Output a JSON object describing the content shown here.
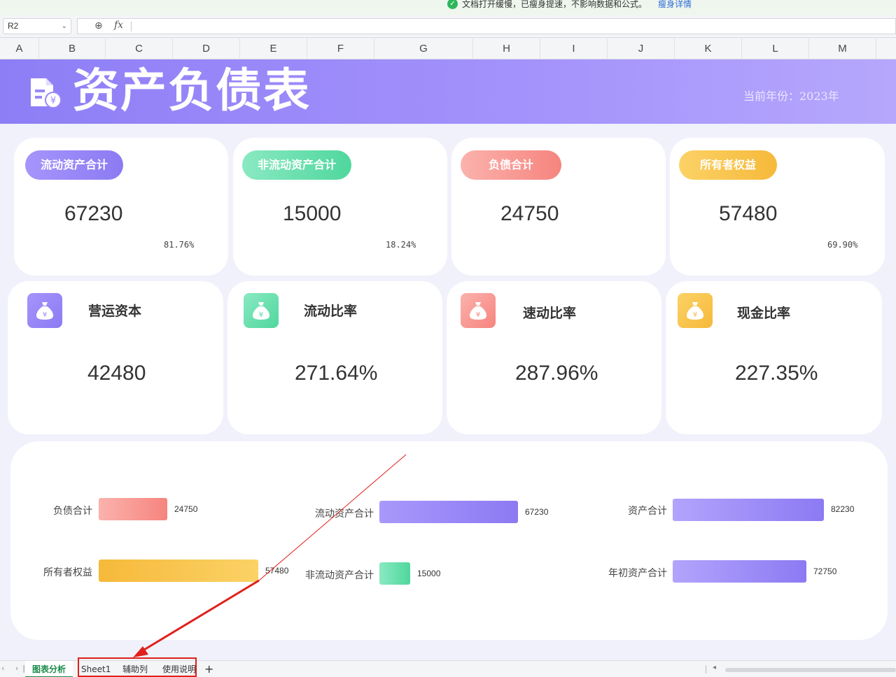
{
  "notice": {
    "message": "文档打开缓慢，已瘦身提速，不影响数据和公式。",
    "link": "瘦身详情"
  },
  "formula_bar": {
    "cell_ref": "R2",
    "fx_label": "fx"
  },
  "columns": [
    "A",
    "B",
    "C",
    "D",
    "E",
    "F",
    "G",
    "H",
    "I",
    "J",
    "K",
    "L",
    "M"
  ],
  "header": {
    "title": "资产负债表",
    "year_label": "当前年份：2023年"
  },
  "kpis": [
    {
      "label": "流动资产合计",
      "value": "67230",
      "percent": "81.76%"
    },
    {
      "label": "非流动资产合计",
      "value": "15000",
      "percent": "18.24%"
    },
    {
      "label": "负债合计",
      "value": "24750",
      "percent": ""
    },
    {
      "label": "所有者权益",
      "value": "57480",
      "percent": "69.90%"
    }
  ],
  "ratios": [
    {
      "label": "营运资本",
      "value": "42480"
    },
    {
      "label": "流动比率",
      "value": "271.64%"
    },
    {
      "label": "速动比率",
      "value": "287.96%"
    },
    {
      "label": "现金比率",
      "value": "227.35%"
    }
  ],
  "colors": {
    "purple": "#9a88f7",
    "green": "#5fe0a8",
    "red": "#f8918c",
    "yellow": "#f8c14a",
    "tab_active": "#1a8a4a",
    "highlight": "#e0201c"
  },
  "chart_data": [
    {
      "type": "bar",
      "orientation": "horizontal",
      "categories": [
        "负债合计",
        "所有者权益"
      ],
      "values": [
        24750,
        57480
      ],
      "xlim": [
        0,
        57480
      ]
    },
    {
      "type": "bar",
      "orientation": "horizontal",
      "categories": [
        "流动资产合计",
        "非流动资产合计"
      ],
      "values": [
        67230,
        15000
      ],
      "xlim": [
        0,
        67230
      ]
    },
    {
      "type": "bar",
      "orientation": "horizontal",
      "categories": [
        "资产合计",
        "年初资产合计"
      ],
      "values": [
        82230,
        72750
      ],
      "xlim": [
        0,
        82230
      ]
    }
  ],
  "sheet_tabs": {
    "tabs": [
      "图表分析",
      "Sheet1",
      "辅助列",
      "使用说明"
    ],
    "add_label": "+"
  },
  "icons": {
    "notice": "check-circle-icon",
    "zoom": "zoom-icon",
    "header": "document-yuan-icon",
    "ratio": "money-bag-icon"
  }
}
